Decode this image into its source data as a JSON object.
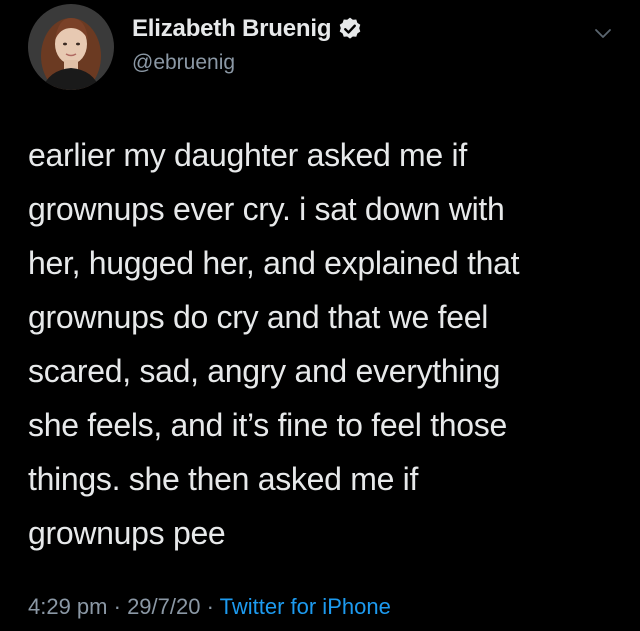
{
  "author": {
    "display_name": "Elizabeth Bruenig",
    "handle": "@ebruenig",
    "verified": true
  },
  "tweet": {
    "lines": [
      "earlier my daughter asked me if",
      "grownups ever cry. i sat down with",
      "her, hugged her, and explained that",
      "grownups do cry and that we feel",
      "scared, sad, angry and everything",
      "she feels, and it’s fine to feel those",
      "things. she then asked me if",
      "grownups pee"
    ]
  },
  "meta": {
    "time": "4:29 pm",
    "separator": " · ",
    "date": "29/7/20",
    "source": "Twitter for iPhone"
  },
  "icons": {
    "verified": "verified-badge-icon",
    "more": "chevron-down-icon"
  },
  "colors": {
    "background": "#000000",
    "text": "#e7e9ea",
    "secondary": "#8b98a5",
    "link": "#1d9bf0"
  }
}
